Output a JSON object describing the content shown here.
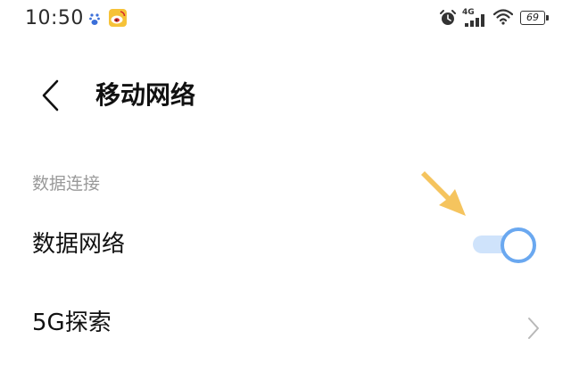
{
  "status_bar": {
    "time": "10:50",
    "network_type": "4G",
    "battery_level": "69",
    "icons": [
      "paw-icon",
      "weibo-icon",
      "alarm-icon",
      "signal-icon",
      "wifi-icon",
      "battery-icon"
    ]
  },
  "header": {
    "title": "移动网络",
    "back_icon": "chevron-left-icon"
  },
  "section": {
    "label": "数据连接"
  },
  "rows": {
    "data_network": {
      "label": "数据网络",
      "toggle_on": true
    },
    "fiveg_explore": {
      "label": "5G探索",
      "icon": "chevron-right-icon"
    }
  },
  "colors": {
    "toggle_track": "#cfe3fb",
    "toggle_knob_border": "#6aa8f0",
    "section_label": "#9a9a9a",
    "annotation_arrow": "#f5c45e"
  }
}
